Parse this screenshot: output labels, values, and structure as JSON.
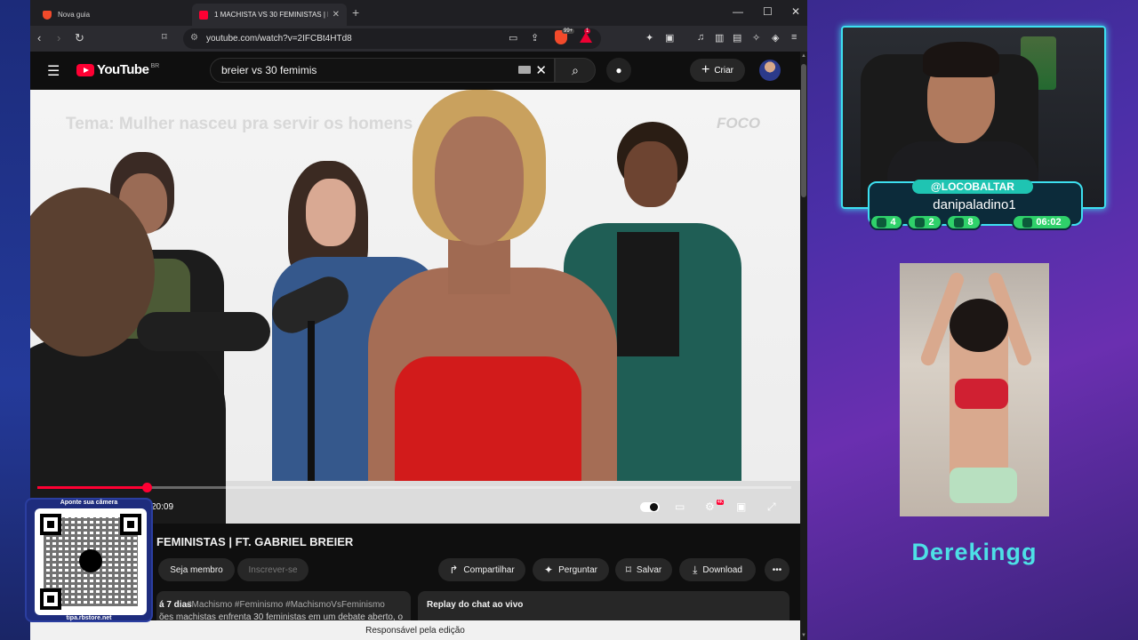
{
  "browser": {
    "tabs": [
      {
        "label": "Nova guia",
        "active": false
      },
      {
        "label": "1 MACHISTA VS 30 FEMINISTAS | FT. G...",
        "active": true
      }
    ],
    "url": "youtube.com/watch?v=2IFCBt4HTd8",
    "shield_badge": "99+",
    "rewards_badge": "1"
  },
  "youtube": {
    "logo": "YouTube",
    "country": "BR",
    "search_query": "breier vs 30 femimis",
    "create_label": "Criar",
    "video": {
      "watermark": "Tema: Mulher nasceu pra servir os homens",
      "channel_logo": "FOCO",
      "time": "20:09",
      "progress": 0.145
    },
    "title": "FEMINISTAS | FT. GABRIEL BREIER",
    "actions": {
      "join": "Seja membro",
      "subscribe": "Inscrever-se",
      "share": "Compartilhar",
      "ask": "Perguntar",
      "save": "Salvar",
      "download": "Download"
    },
    "description": {
      "date": "á 7 dias",
      "tags": "#Machismo #Feminismo #MachismoVsFeminismo",
      "line": "ões machistas enfrenta 30 feministas em um debate aberto, o"
    },
    "chat_replay": "Replay do chat ao vivo",
    "notice": "Responsável pela edição"
  },
  "qr": {
    "label": "Aponte sua câmera",
    "site": "tipa.rbstore.net"
  },
  "stream": {
    "handle": "@LOCOBALTAR",
    "viewer_name": "danipaladino1",
    "stats": [
      {
        "icon": "chat-icon",
        "value": "4"
      },
      {
        "icon": "youtube-icon",
        "value": "2"
      },
      {
        "icon": "tip-icon",
        "value": "8"
      },
      {
        "icon": "whatsapp-icon",
        "value": "06:02"
      }
    ],
    "streamer_name": "Derekingg"
  },
  "colors": {
    "accent_cyan": "#3de0f0",
    "youtube_red": "#ff0033",
    "stat_green": "#2fd16a"
  }
}
